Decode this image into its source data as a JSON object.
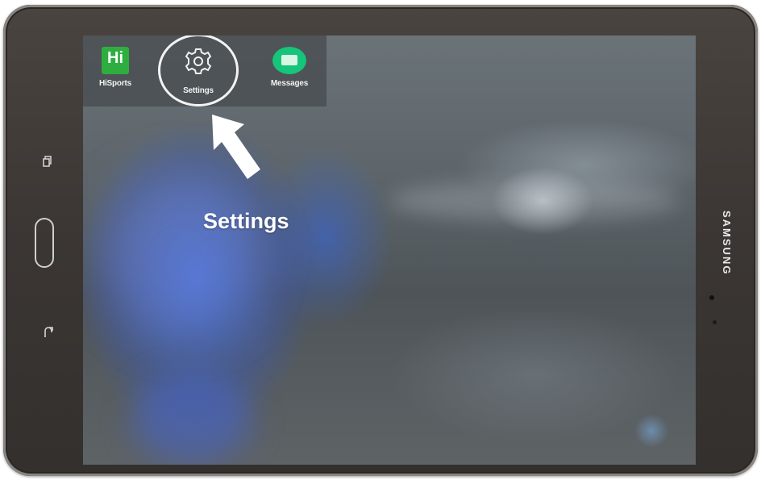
{
  "apps": [
    {
      "label": "HiSports",
      "icon": "hisports-icon",
      "icon_text": "Hi"
    },
    {
      "label": "Settings",
      "icon": "gear-icon"
    },
    {
      "label": "Messages",
      "icon": "chat-bubble-icon"
    }
  ],
  "annotation": {
    "caption": "Settings",
    "target": "Settings"
  },
  "device": {
    "brand": "SAMSUNG"
  },
  "colors": {
    "hisports": "#2eae3f",
    "messages": "#16c47a",
    "bezel": "#3b3633"
  }
}
